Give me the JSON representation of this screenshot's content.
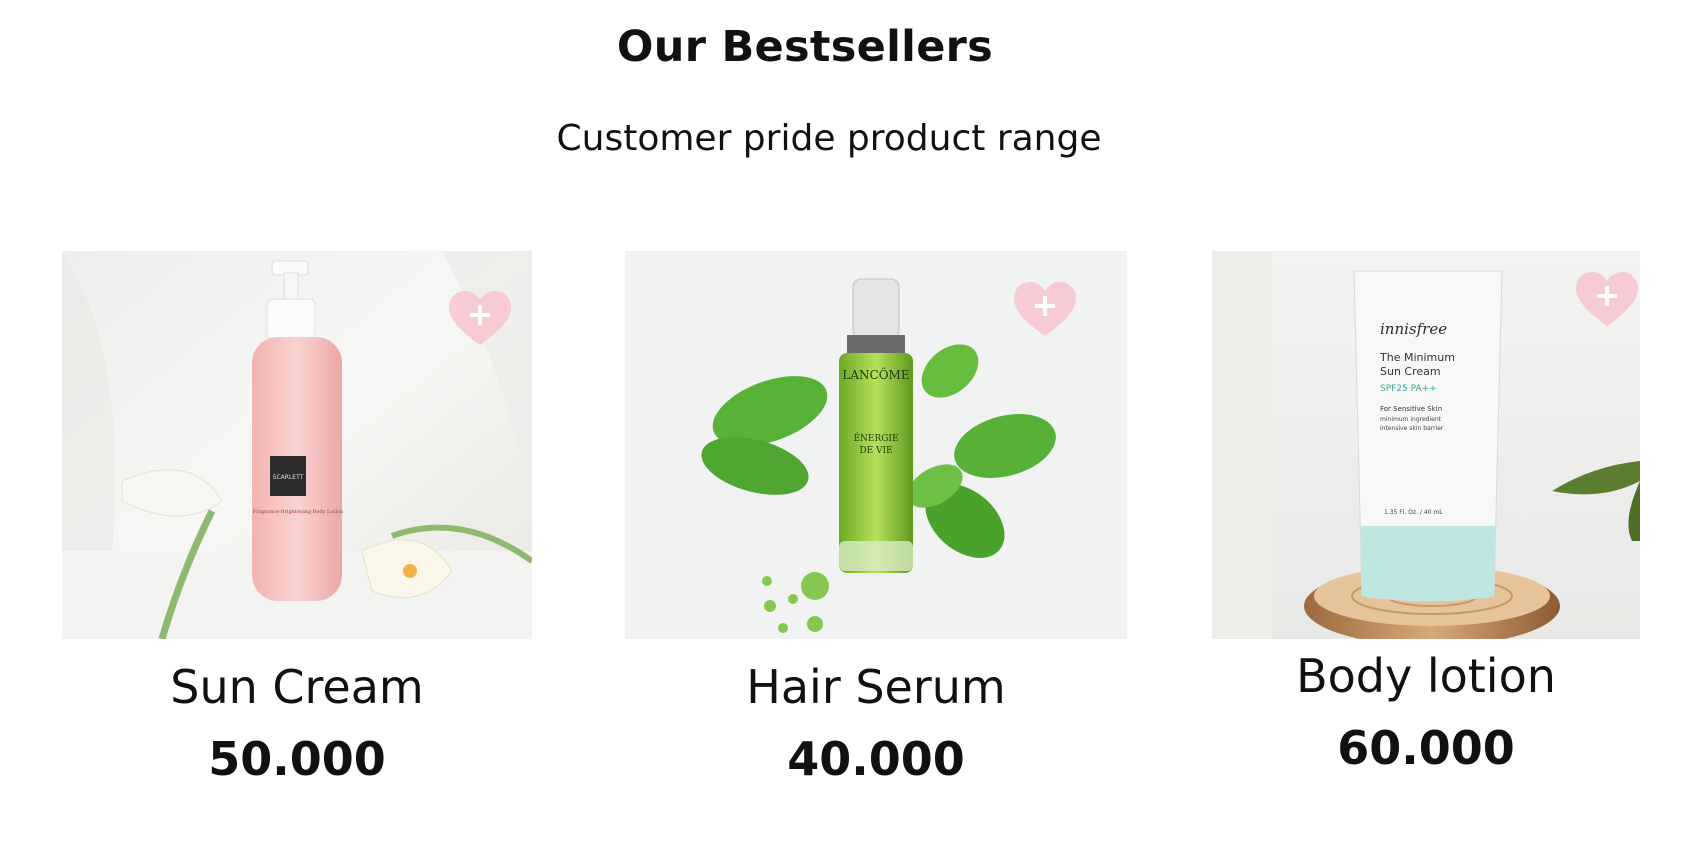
{
  "section": {
    "title": "Our Bestsellers",
    "subtitle": "Customer pride product range"
  },
  "products": [
    {
      "name": "Sun Cream",
      "price": "50.000",
      "image_icon": "body-lotion-bottle-photo",
      "wishlist_icon": "heart-plus-icon",
      "image_text": {
        "brand": "SCARLETT",
        "label": "Fragrance Brightening Body Lotion"
      }
    },
    {
      "name": "Hair Serum",
      "price": "40.000",
      "image_icon": "serum-bottle-photo",
      "wishlist_icon": "heart-plus-icon",
      "image_text": {
        "brand": "LANCÔME",
        "label_1": "ÉNERGIE",
        "label_2": "DE VIE"
      }
    },
    {
      "name": "Body lotion",
      "price": "60.000",
      "image_icon": "sun-cream-tube-photo",
      "wishlist_icon": "heart-plus-icon",
      "image_text": {
        "brand": "innisfree",
        "line_1": "The Minimum",
        "line_2": "Sun Cream",
        "line_3": "SPF25 PA++",
        "line_4": "For Sensitive Skin",
        "line_5": "minimum ingredient",
        "line_6": "intensive skin barrier",
        "line_7": "1.35 Fl. Oz. / 40 mL"
      }
    }
  ],
  "colors": {
    "heart_fill": "#f6c7cf",
    "text": "#111111",
    "background": "#ffffff"
  }
}
